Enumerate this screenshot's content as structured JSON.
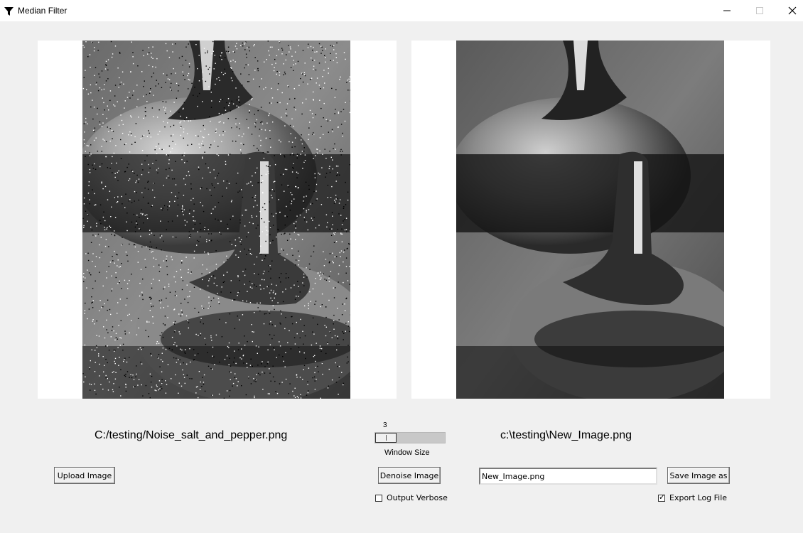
{
  "window": {
    "title": "Median Filter",
    "icon": "funnel-icon",
    "controls": [
      "minimize-icon",
      "maximize-icon",
      "close-icon"
    ]
  },
  "images": {
    "input_path": "C:/testing/Noise_salt_and_pepper.png",
    "output_path": "c:\\testing\\New_Image.png"
  },
  "slider": {
    "value": "3",
    "label": "Window Size"
  },
  "buttons": {
    "upload": "Upload Image",
    "denoise": "Denoise Image",
    "save": "Save Image as"
  },
  "filename_input": {
    "value": "New_Image.png"
  },
  "checkboxes": {
    "verbose": {
      "label": "Output Verbose",
      "checked": false
    },
    "export_log": {
      "label": "Export Log File",
      "checked": true
    }
  }
}
